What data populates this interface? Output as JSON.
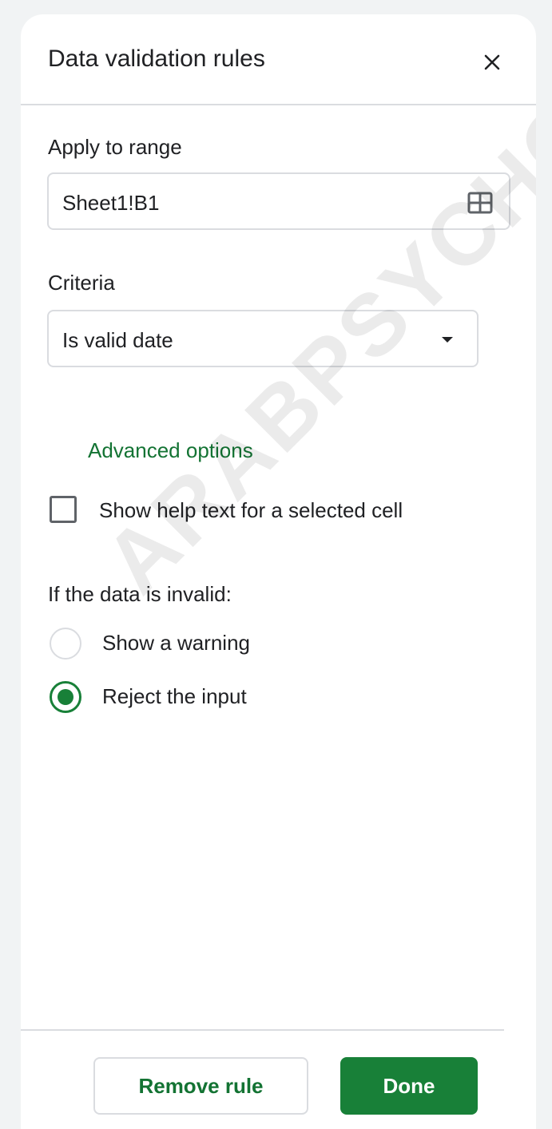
{
  "panel": {
    "title": "Data validation rules",
    "close_icon": "close-icon"
  },
  "range": {
    "label": "Apply to range",
    "value": "Sheet1!B1",
    "icon": "select-range-grid-icon"
  },
  "criteria": {
    "label": "Criteria",
    "selected": "Is valid date",
    "icon": "dropdown-caret-icon"
  },
  "advanced": {
    "label": "Advanced options",
    "help_text_checkbox": {
      "label": "Show help text for a selected cell",
      "checked": false
    },
    "invalid_heading": "If the data is invalid:",
    "options": [
      {
        "label": "Show a warning",
        "selected": false
      },
      {
        "label": "Reject the input",
        "selected": true
      }
    ]
  },
  "footer": {
    "remove_label": "Remove rule",
    "done_label": "Done"
  },
  "watermark": "ARABPSYCHO",
  "colors": {
    "accent": "#188038",
    "accent_text": "#137333",
    "border": "#dadce0",
    "text": "#202124"
  }
}
